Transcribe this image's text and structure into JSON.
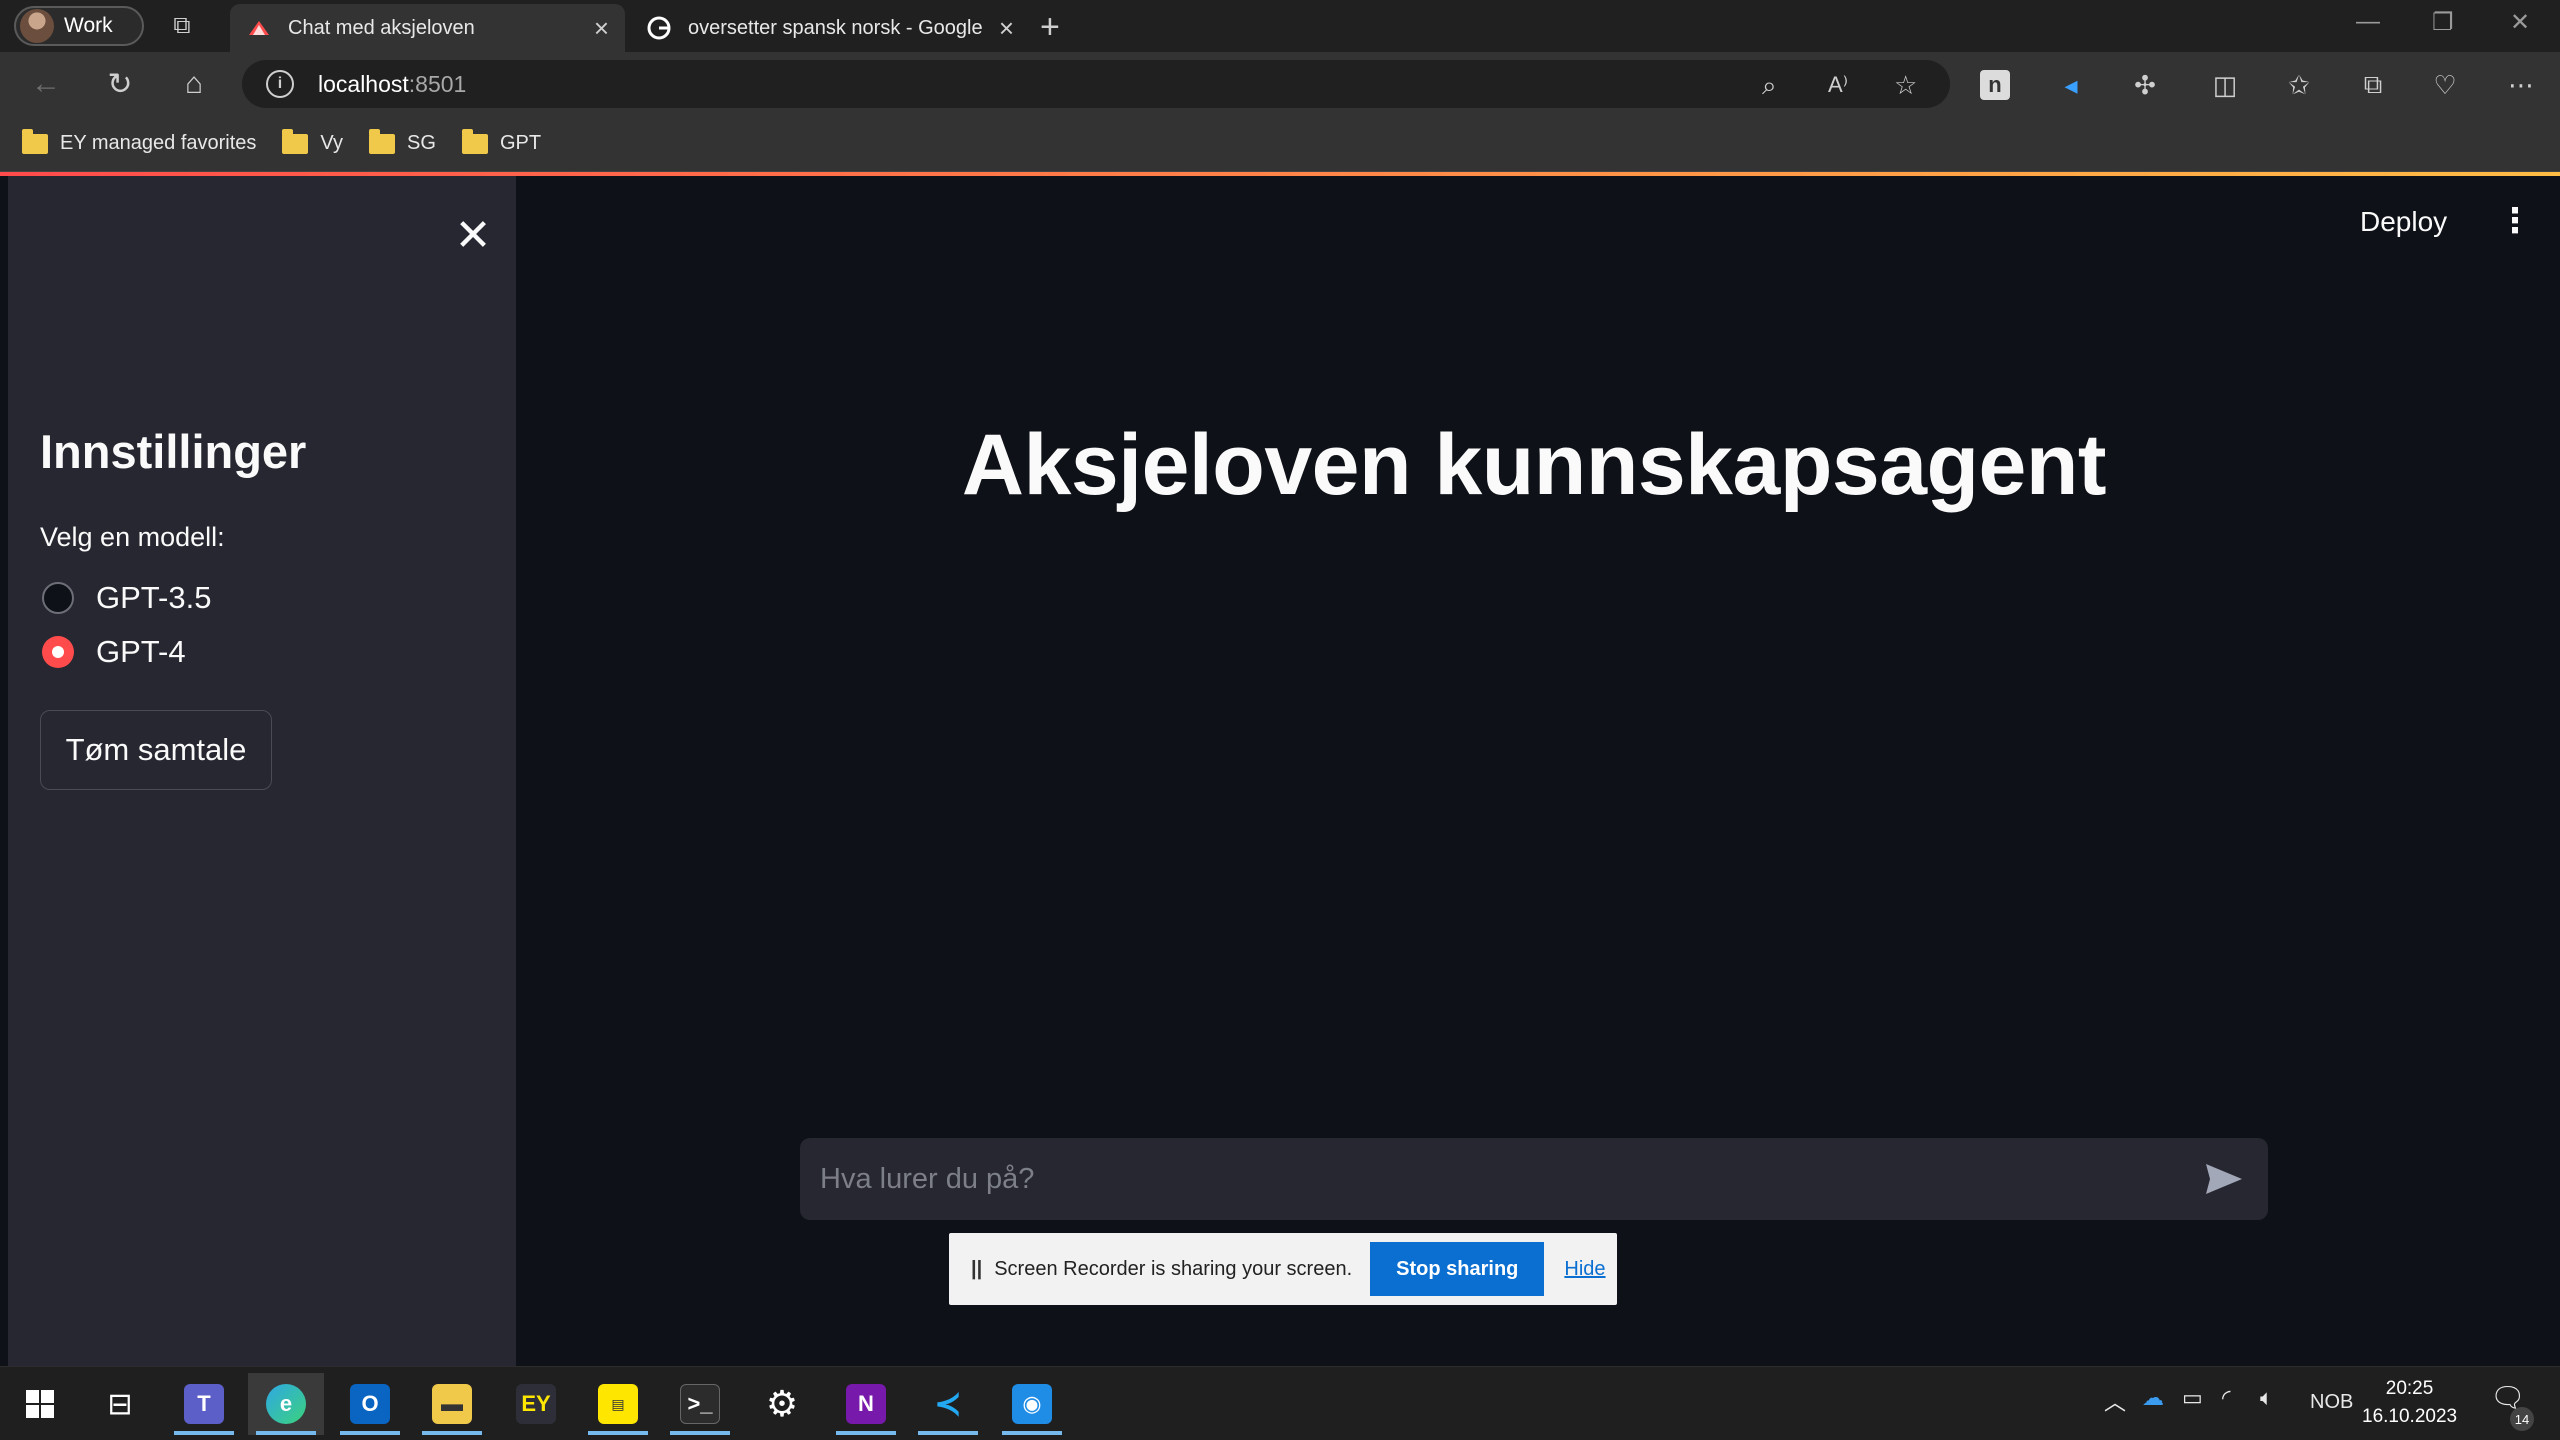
{
  "browser": {
    "profile_label": "Work",
    "tabs": [
      {
        "title": "Chat med aksjeloven",
        "active": true
      },
      {
        "title": "oversetter spansk norsk - Google",
        "active": false
      }
    ],
    "url_host": "localhost",
    "url_port": ":8501",
    "favorites": [
      {
        "label": "EY managed favorites"
      },
      {
        "label": "Vy"
      },
      {
        "label": "SG"
      },
      {
        "label": "GPT"
      }
    ]
  },
  "sidebar": {
    "title": "Innstillinger",
    "model_label": "Velg en modell:",
    "options": [
      {
        "label": "GPT-3.5",
        "selected": false
      },
      {
        "label": "GPT-4",
        "selected": true
      }
    ],
    "clear_button": "Tøm samtale"
  },
  "header": {
    "deploy_label": "Deploy"
  },
  "main": {
    "title": "Aksjeloven kunnskapsagent",
    "chat_placeholder": "Hva lurer du på?"
  },
  "share_notice": {
    "message": "Screen Recorder is sharing your screen.",
    "stop_label": "Stop sharing",
    "hide_label": "Hide"
  },
  "taskbar": {
    "language": "NOB",
    "time": "20:25",
    "date": "16.10.2023",
    "notifications": "14"
  },
  "colors": {
    "accent": "#ff4b4b",
    "background": "#0e1117",
    "sidebar": "#262730",
    "share_button": "#0a6fd1"
  }
}
